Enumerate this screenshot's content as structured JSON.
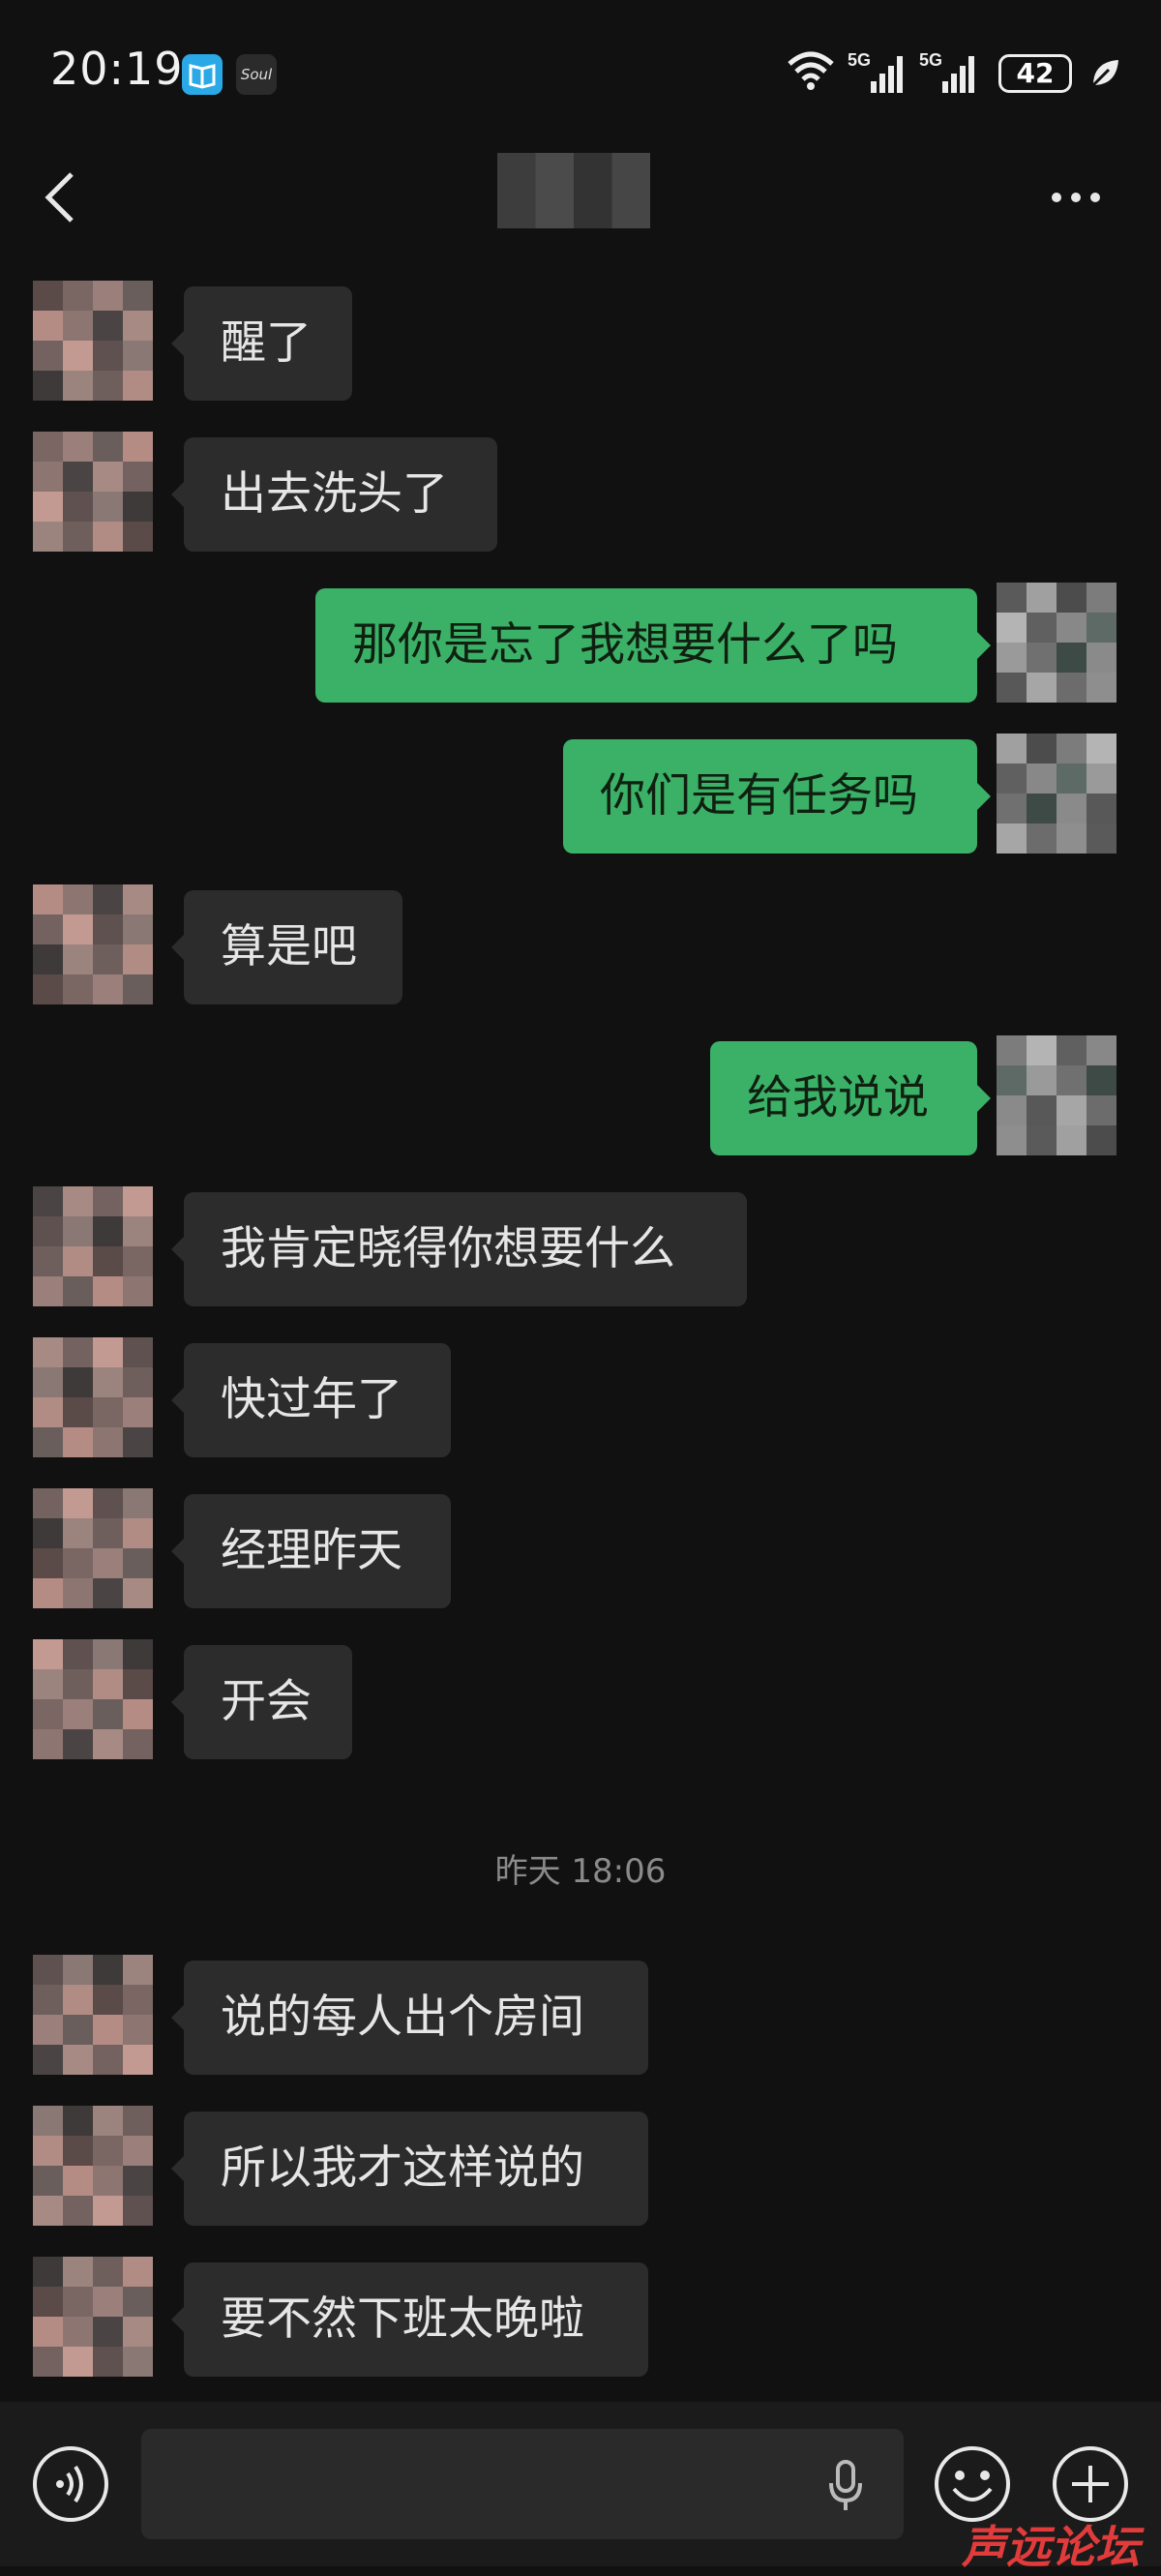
{
  "status_bar": {
    "time": "20:19",
    "apps": [
      "book-icon",
      "soul-icon"
    ],
    "soul_label": "Soul",
    "network1": "5G",
    "network2": "5G",
    "battery": "42"
  },
  "header": {
    "back_icon": "chevron-left-icon",
    "more_icon": "more-dots-icon"
  },
  "messages": [
    {
      "side": "in",
      "text": "醒了"
    },
    {
      "side": "in",
      "text": "出去洗头了"
    },
    {
      "side": "out",
      "text": "那你是忘了我想要什么了吗"
    },
    {
      "side": "out",
      "text": "你们是有任务吗"
    },
    {
      "side": "in",
      "text": "算是吧"
    },
    {
      "side": "out",
      "text": "给我说说"
    },
    {
      "side": "in",
      "text": "我肯定晓得你想要什么"
    },
    {
      "side": "in",
      "text": "快过年了"
    },
    {
      "side": "in",
      "text": "经理昨天"
    },
    {
      "side": "in",
      "text": "开会"
    },
    {
      "side": "in",
      "text": "说的每人出个房间"
    },
    {
      "side": "in",
      "text": "所以我才这样说的"
    },
    {
      "side": "in",
      "text": "要不然下班太晚啦"
    }
  ],
  "timestamp": "昨天 18:06",
  "bottom_bar": {
    "voice_icon": "voice-toggle-icon",
    "mic_icon": "microphone-icon",
    "emoji_icon": "emoji-icon",
    "plus_icon": "plus-icon"
  },
  "watermark": "声远论坛",
  "colors": {
    "background": "#111111",
    "incoming_bubble": "#2c2c2c",
    "outgoing_bubble": "#3bb168",
    "timestamp": "#8a8a8a"
  }
}
